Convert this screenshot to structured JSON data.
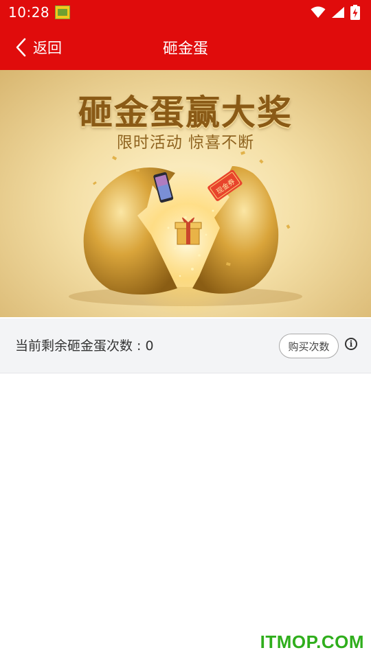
{
  "status_bar": {
    "time": "10:28",
    "icons": [
      "app-notification-icon",
      "wifi-icon",
      "cell-signal-icon",
      "battery-charging-icon"
    ]
  },
  "nav": {
    "back_label": "返回",
    "title": "砸金蛋"
  },
  "banner": {
    "headline": "砸金蛋赢大奖",
    "subline": "限时活动 惊喜不断",
    "coupon_text": "现金券",
    "icons": [
      "phone-prize-icon",
      "coupon-prize-icon",
      "gift-box-icon",
      "golden-egg-left",
      "golden-egg-right"
    ]
  },
  "counter": {
    "label": "当前剩余砸金蛋次数 : 0",
    "buy_label": "购买次数",
    "info_glyph": "i"
  },
  "watermark": "ITMOP.COM",
  "colors": {
    "primary_red": "#e00c0c",
    "counter_bg": "#f3f4f6",
    "watermark_green": "#2fae1c",
    "gold": "#d9a43a"
  }
}
